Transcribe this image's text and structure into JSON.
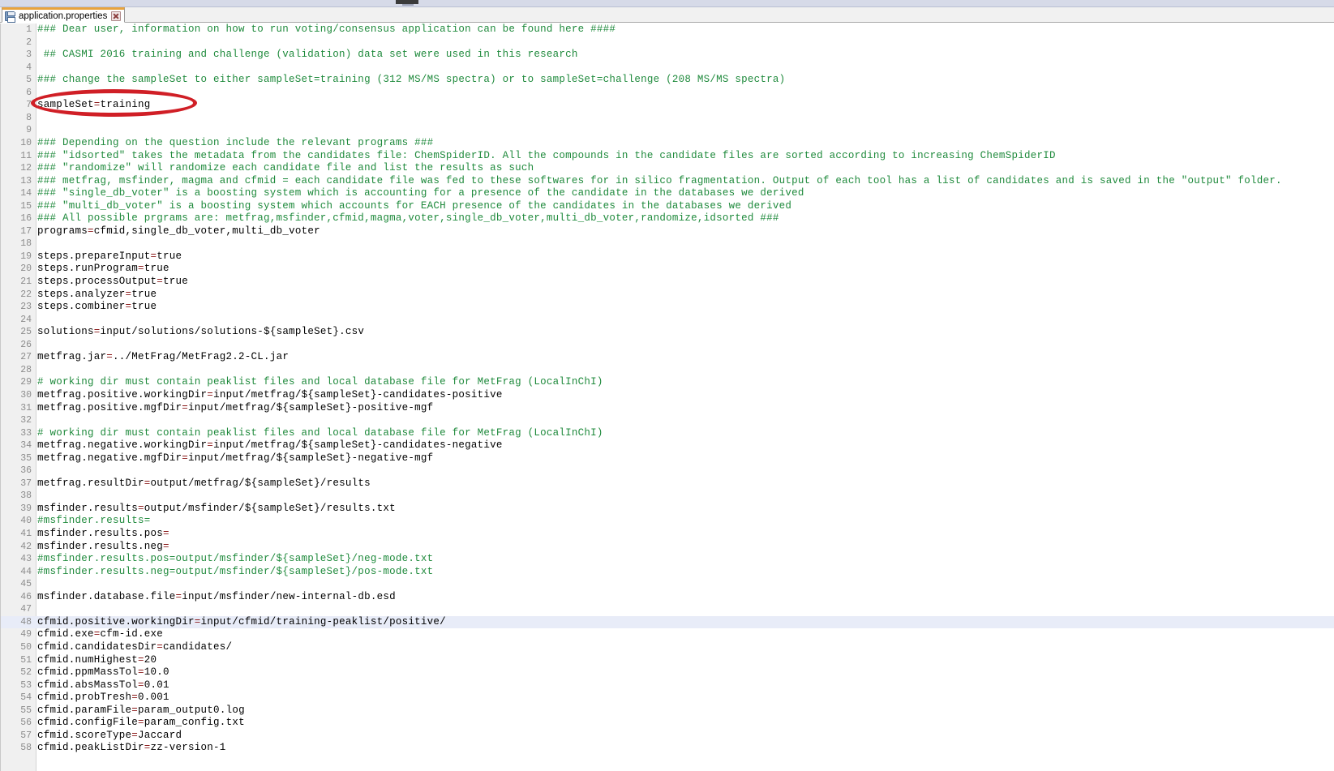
{
  "window": {
    "top_bar_color": "#d6dae8"
  },
  "tab": {
    "label": "application.properties",
    "save_icon": "disk-icon",
    "close_icon": "close-icon"
  },
  "annotation": {
    "shape": "ellipse",
    "color": "#d01f26",
    "targets_line": 7,
    "targets_text": "sampleSet=training"
  },
  "editor": {
    "language": "properties",
    "current_line": 48,
    "colors": {
      "comment": "#1f8a3c",
      "key": "#000000",
      "equals": "#8b1a1a",
      "value": "#000000",
      "gutter_bg": "#f0f0f0",
      "line_number": "#8c8c8c",
      "current_line_bg": "#e8ecf8"
    },
    "lines": [
      {
        "n": 1,
        "text": "### Dear user, information on how to run voting/consensus application can be found here ####",
        "type": "comment"
      },
      {
        "n": 2,
        "text": "",
        "type": "blank"
      },
      {
        "n": 3,
        "text": " ## CASMI 2016 training and challenge (validation) data set were used in this research",
        "type": "comment"
      },
      {
        "n": 4,
        "text": "",
        "type": "blank"
      },
      {
        "n": 5,
        "text": "### change the sampleSet to either sampleSet=training (312 MS/MS spectra) or to sampleSet=challenge (208 MS/MS spectra)",
        "type": "comment"
      },
      {
        "n": 6,
        "text": "",
        "type": "blank"
      },
      {
        "n": 7,
        "text": "sampleSet=training",
        "type": "property"
      },
      {
        "n": 8,
        "text": "",
        "type": "blank"
      },
      {
        "n": 9,
        "text": "",
        "type": "blank"
      },
      {
        "n": 10,
        "text": "### Depending on the question include the relevant programs ###",
        "type": "comment"
      },
      {
        "n": 11,
        "text": "### \"idsorted\" takes the metadata from the candidates file: ChemSpiderID. All the compounds in the candidate files are sorted according to increasing ChemSpiderID",
        "type": "comment"
      },
      {
        "n": 12,
        "text": "### \"randomize\" will randomize each candidate file and list the results as such",
        "type": "comment"
      },
      {
        "n": 13,
        "text": "### metfrag, msfinder, magma and cfmid = each candidate file was fed to these softwares for in silico fragmentation. Output of each tool has a list of candidates and is saved in the \"output\" folder.",
        "type": "comment"
      },
      {
        "n": 14,
        "text": "### \"single_db_voter\" is a boosting system which is accounting for a presence of the candidate in the databases we derived",
        "type": "comment"
      },
      {
        "n": 15,
        "text": "### \"multi_db_voter\" is a boosting system which accounts for EACH presence of the candidates in the databases we derived",
        "type": "comment"
      },
      {
        "n": 16,
        "text": "### All possible prgrams are: metfrag,msfinder,cfmid,magma,voter,single_db_voter,multi_db_voter,randomize,idsorted ###",
        "type": "comment"
      },
      {
        "n": 17,
        "text": "programs=cfmid,single_db_voter,multi_db_voter",
        "type": "property"
      },
      {
        "n": 18,
        "text": "",
        "type": "blank"
      },
      {
        "n": 19,
        "text": "steps.prepareInput=true",
        "type": "property"
      },
      {
        "n": 20,
        "text": "steps.runProgram=true",
        "type": "property"
      },
      {
        "n": 21,
        "text": "steps.processOutput=true",
        "type": "property"
      },
      {
        "n": 22,
        "text": "steps.analyzer=true",
        "type": "property"
      },
      {
        "n": 23,
        "text": "steps.combiner=true",
        "type": "property"
      },
      {
        "n": 24,
        "text": "",
        "type": "blank"
      },
      {
        "n": 25,
        "text": "solutions=input/solutions/solutions-${sampleSet}.csv",
        "type": "property"
      },
      {
        "n": 26,
        "text": "",
        "type": "blank"
      },
      {
        "n": 27,
        "text": "metfrag.jar=../MetFrag/MetFrag2.2-CL.jar",
        "type": "property"
      },
      {
        "n": 28,
        "text": "",
        "type": "blank"
      },
      {
        "n": 29,
        "text": "# working dir must contain peaklist files and local database file for MetFrag (LocalInChI)",
        "type": "comment"
      },
      {
        "n": 30,
        "text": "metfrag.positive.workingDir=input/metfrag/${sampleSet}-candidates-positive",
        "type": "property"
      },
      {
        "n": 31,
        "text": "metfrag.positive.mgfDir=input/metfrag/${sampleSet}-positive-mgf",
        "type": "property"
      },
      {
        "n": 32,
        "text": "",
        "type": "blank"
      },
      {
        "n": 33,
        "text": "# working dir must contain peaklist files and local database file for MetFrag (LocalInChI)",
        "type": "comment"
      },
      {
        "n": 34,
        "text": "metfrag.negative.workingDir=input/metfrag/${sampleSet}-candidates-negative",
        "type": "property"
      },
      {
        "n": 35,
        "text": "metfrag.negative.mgfDir=input/metfrag/${sampleSet}-negative-mgf",
        "type": "property"
      },
      {
        "n": 36,
        "text": "",
        "type": "blank"
      },
      {
        "n": 37,
        "text": "metfrag.resultDir=output/metfrag/${sampleSet}/results",
        "type": "property"
      },
      {
        "n": 38,
        "text": "",
        "type": "blank"
      },
      {
        "n": 39,
        "text": "msfinder.results=output/msfinder/${sampleSet}/results.txt",
        "type": "property"
      },
      {
        "n": 40,
        "text": "#msfinder.results=",
        "type": "comment"
      },
      {
        "n": 41,
        "text": "msfinder.results.pos=",
        "type": "property"
      },
      {
        "n": 42,
        "text": "msfinder.results.neg=",
        "type": "property"
      },
      {
        "n": 43,
        "text": "#msfinder.results.pos=output/msfinder/${sampleSet}/neg-mode.txt",
        "type": "comment"
      },
      {
        "n": 44,
        "text": "#msfinder.results.neg=output/msfinder/${sampleSet}/pos-mode.txt",
        "type": "comment"
      },
      {
        "n": 45,
        "text": "",
        "type": "blank"
      },
      {
        "n": 46,
        "text": "msfinder.database.file=input/msfinder/new-internal-db.esd",
        "type": "property"
      },
      {
        "n": 47,
        "text": "",
        "type": "blank"
      },
      {
        "n": 48,
        "text": "cfmid.positive.workingDir=input/cfmid/training-peaklist/positive/",
        "type": "property"
      },
      {
        "n": 49,
        "text": "cfmid.exe=cfm-id.exe",
        "type": "property"
      },
      {
        "n": 50,
        "text": "cfmid.candidatesDir=candidates/",
        "type": "property"
      },
      {
        "n": 51,
        "text": "cfmid.numHighest=20",
        "type": "property"
      },
      {
        "n": 52,
        "text": "cfmid.ppmMassTol=10.0",
        "type": "property"
      },
      {
        "n": 53,
        "text": "cfmid.absMassTol=0.01",
        "type": "property"
      },
      {
        "n": 54,
        "text": "cfmid.probTresh=0.001",
        "type": "property"
      },
      {
        "n": 55,
        "text": "cfmid.paramFile=param_output0.log",
        "type": "property"
      },
      {
        "n": 56,
        "text": "cfmid.configFile=param_config.txt",
        "type": "property"
      },
      {
        "n": 57,
        "text": "cfmid.scoreType=Jaccard",
        "type": "property"
      },
      {
        "n": 58,
        "text": "cfmid.peakListDir=zz-version-1",
        "type": "property"
      }
    ]
  }
}
